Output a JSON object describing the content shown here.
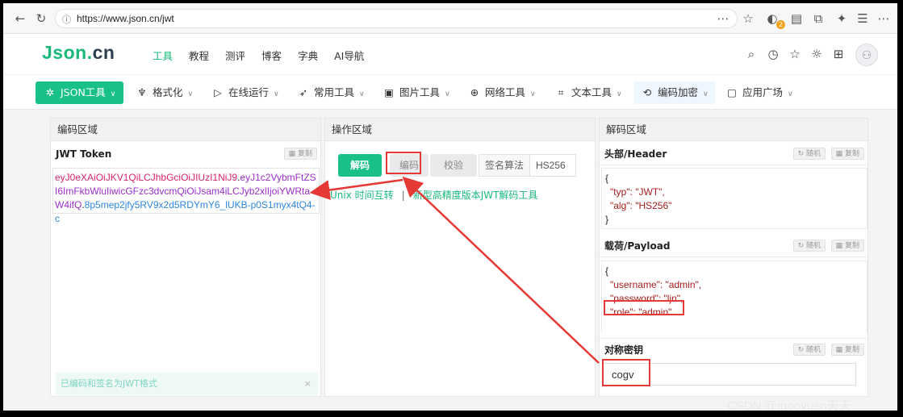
{
  "browser": {
    "url": "https://www.json.cn/jwt",
    "extension_badge": "2"
  },
  "site": {
    "logo_main": "Json",
    "logo_dot": ".",
    "logo_suffix": "cn",
    "nav": [
      "工具",
      "教程",
      "测评",
      "博客",
      "字典",
      "AI导航"
    ]
  },
  "toolbar": {
    "items": [
      {
        "label": "JSON工具",
        "icon": "sparkle-icon"
      },
      {
        "label": "格式化",
        "icon": "brush-icon"
      },
      {
        "label": "在线运行",
        "icon": "play-icon"
      },
      {
        "label": "常用工具",
        "icon": "rocket-icon"
      },
      {
        "label": "图片工具",
        "icon": "image-icon"
      },
      {
        "label": "网络工具",
        "icon": "globe-icon"
      },
      {
        "label": "文本工具",
        "icon": "text-icon"
      },
      {
        "label": "编码加密",
        "icon": "refresh-icon"
      },
      {
        "label": "应用广场",
        "icon": "bag-icon"
      }
    ]
  },
  "encode_panel": {
    "title": "编码区域",
    "token_label": "JWT Token",
    "copy_label": "复制",
    "token_header": "eyJ0eXAiOiJKV1QiLCJhbGciOiJIUzI1NiJ9",
    "token_payload": "eyJ1c2VybmFtZSI6ImFkbWluIiwicGFzc3dvcmQiOiJsam4iLCJyb2xlIjoiYWRtaW4ifQ",
    "token_signature": "8p5mep2jfy5RV9x2d5RDYmY6_lUKB-p0S1myx4tQ4-c",
    "status_text": "已编码和签名为JWT格式",
    "close_symbol": "×"
  },
  "op_panel": {
    "title": "操作区域",
    "decode_label": "解码",
    "encode_label": "编码",
    "verify_label": "校验",
    "alg_label": "签名算法",
    "alg_value": "HS256",
    "link1": "Unix 时间互转",
    "separator": "|",
    "link2": "新型高精度版本JWT解码工具"
  },
  "decode_panel": {
    "title": "解码区域",
    "header_label": "头部/Header",
    "payload_label": "载荷/Payload",
    "secret_label": "对称密钥",
    "random_label": "随机",
    "copy_label": "复制",
    "header_lines": [
      "{",
      "\"typ\": \"JWT\",",
      "\"alg\": \"HS256\"",
      "}"
    ],
    "payload_lines": [
      "{",
      "\"username\": \"admin\",",
      "\"password\": \"ljn\",",
      "\"role\": \"admin\""
    ],
    "secret_value": "cogv"
  },
  "watermark": "CSDN @mooyuan天天",
  "colors": {
    "brand_green": "#19c08a",
    "annotation_red": "#e53935"
  }
}
